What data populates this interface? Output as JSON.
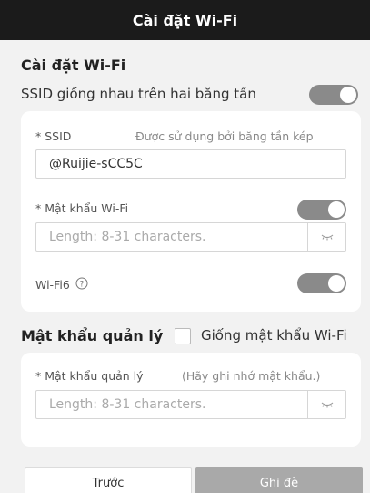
{
  "window": {
    "title": "Cài đặt Wi-Fi"
  },
  "wifi_section": {
    "title": "Cài đặt Wi-Fi",
    "same_ssid_label": "SSID giống nhau trên hai băng tần",
    "same_ssid_on": true
  },
  "ssid": {
    "label": "* SSID",
    "hint": "Được sử dụng bởi băng tần kép",
    "value": "@Ruijie-sCC5C"
  },
  "wifi_password": {
    "label": "* Mật khẩu Wi-Fi",
    "placeholder": "Length: 8-31 characters.",
    "enabled": true
  },
  "wifi6": {
    "label": "Wi-Fi6",
    "help_icon": "help-circle-icon",
    "enabled": true
  },
  "admin_section": {
    "title": "Mật khẩu quản lý",
    "same_as_wifi_label": "Giống mật khẩu Wi-Fi",
    "same_as_wifi_checked": false
  },
  "admin_password": {
    "label": "* Mật khẩu quản lý",
    "hint": "(Hãy ghi nhớ mật khẩu.)",
    "placeholder": "Length: 8-31 characters."
  },
  "footer": {
    "prev_label": "Trước",
    "overwrite_label": "Ghi đè"
  },
  "colors": {
    "title_bar": "#1b1b1b",
    "toggle_on": "#8a8a8a",
    "primary_button": "#a9a9a9"
  }
}
